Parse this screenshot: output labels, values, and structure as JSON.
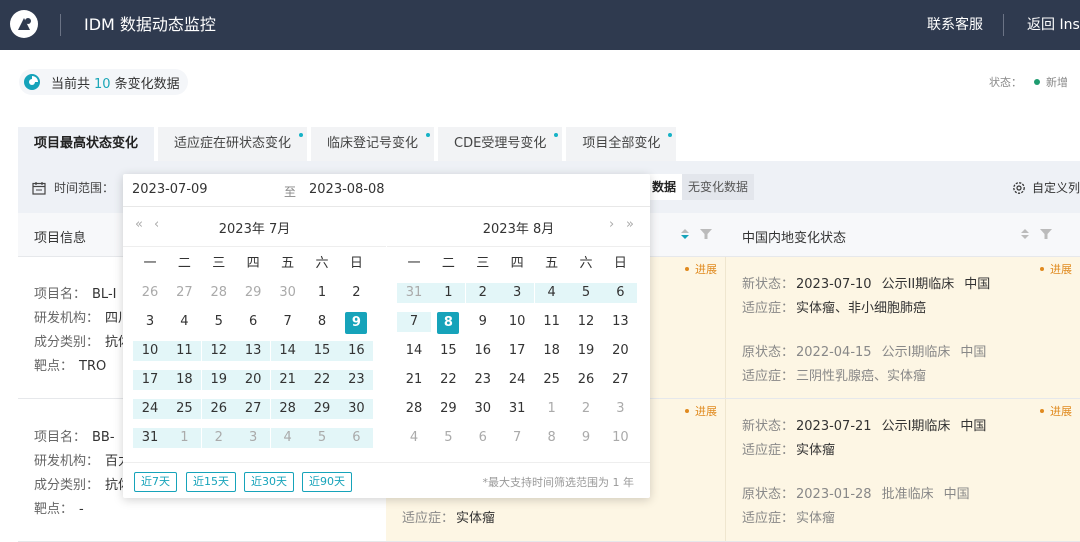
{
  "header": {
    "app_title": "IDM 数据动态监控",
    "contact": "联系客服",
    "back": "返回 Insi",
    "logo_icon": "logo-icon"
  },
  "summary": {
    "prefix": "当前共",
    "count": "10",
    "suffix": "条变化数据",
    "icon": "pie-chart-icon"
  },
  "status_legend": {
    "label": "状态：",
    "item": "新增",
    "item_color": "#1e9c70"
  },
  "tabs": [
    {
      "label": "项目最高状态变化",
      "active": true,
      "dot": false
    },
    {
      "label": "适应症在研状态变化",
      "active": false,
      "dot": true
    },
    {
      "label": "临床登记号变化",
      "active": false,
      "dot": true
    },
    {
      "label": "CDE受理号变化",
      "active": false,
      "dot": true
    },
    {
      "label": "项目全部变化",
      "active": false,
      "dot": true
    }
  ],
  "filter": {
    "time_label": "时间范围：",
    "seg_on": "数据",
    "seg_off": "无变化数据",
    "custom": "自定义列"
  },
  "table": {
    "col_project": "项目信息",
    "col_cn": "中国内地变化状态",
    "rows": [
      {
        "fields": [
          {
            "k": "项目名：",
            "v": "BL-I"
          },
          {
            "k": "研发机构：",
            "v": "四川"
          },
          {
            "k": "成分类别：",
            "v": "抗体"
          },
          {
            "k": "靶点：",
            "v": "TRO"
          }
        ],
        "mid_tag": "进展",
        "right_tag": "进展",
        "new_label": "新状态：",
        "new_date": "2023-07-10",
        "new_phase": "公示II期临床",
        "new_region": "中国",
        "new_ind_label": "适应症：",
        "new_ind": "实体瘤、非小细胞肺癌",
        "old_label": "原状态：",
        "old_date": "2022-04-15",
        "old_phase": "公示I期临床",
        "old_region": "中国",
        "old_ind_label": "适应症：",
        "old_ind": "三阴性乳腺癌、实体瘤"
      },
      {
        "fields": [
          {
            "k": "项目名：",
            "v": "BB-"
          },
          {
            "k": "研发机构：",
            "v": "百力"
          },
          {
            "k": "成分类别：",
            "v": "抗体"
          },
          {
            "k": "靶点：",
            "v": "-"
          }
        ],
        "mid_tag": "进展",
        "mid_ind_label": "适应症：",
        "mid_ind": "实体瘤",
        "right_tag": "进展",
        "new_label": "新状态：",
        "new_date": "2023-07-21",
        "new_phase": "公示I期临床",
        "new_region": "中国",
        "new_ind_label": "适应症：",
        "new_ind": "实体瘤",
        "old_label": "原状态：",
        "old_date": "2023-01-28",
        "old_phase": "批准临床",
        "old_region": "中国",
        "old_ind_label": "适应症：",
        "old_ind": "实体瘤"
      }
    ]
  },
  "picker": {
    "start": "2023-07-09",
    "to": "至",
    "end": "2023-08-08",
    "weekdays": [
      "一",
      "二",
      "三",
      "四",
      "五",
      "六",
      "日"
    ],
    "left": {
      "title": "2023年 7月",
      "weeks": [
        [
          "26",
          "27",
          "28",
          "29",
          "30",
          "1",
          "2"
        ],
        [
          "3",
          "4",
          "5",
          "6",
          "7",
          "8",
          "9"
        ],
        [
          "10",
          "11",
          "12",
          "13",
          "14",
          "15",
          "16"
        ],
        [
          "17",
          "18",
          "19",
          "20",
          "21",
          "22",
          "23"
        ],
        [
          "24",
          "25",
          "26",
          "27",
          "28",
          "29",
          "30"
        ],
        [
          "31",
          "1",
          "2",
          "3",
          "4",
          "5",
          "6"
        ]
      ]
    },
    "right": {
      "title": "2023年 8月",
      "weeks": [
        [
          "31",
          "1",
          "2",
          "3",
          "4",
          "5",
          "6"
        ],
        [
          "7",
          "8",
          "9",
          "10",
          "11",
          "12",
          "13"
        ],
        [
          "14",
          "15",
          "16",
          "17",
          "18",
          "19",
          "20"
        ],
        [
          "21",
          "22",
          "23",
          "24",
          "25",
          "26",
          "27"
        ],
        [
          "28",
          "29",
          "30",
          "31",
          "1",
          "2",
          "3"
        ],
        [
          "4",
          "5",
          "6",
          "7",
          "8",
          "9",
          "10"
        ]
      ]
    },
    "quick": [
      "近7天",
      "近15天",
      "近30天",
      "近90天"
    ],
    "note": "*最大支持时间筛选范围为 1 年",
    "accent_color": "#16a3ba",
    "range_color": "#e3f6f8"
  }
}
